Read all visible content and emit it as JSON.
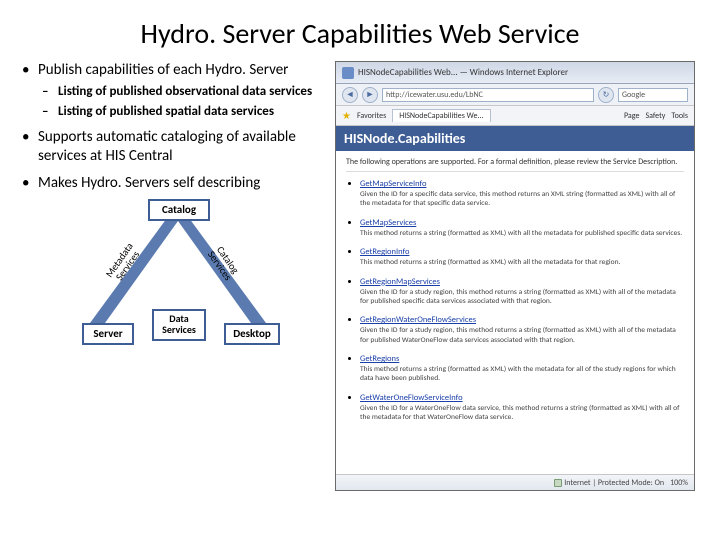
{
  "title": "Hydro. Server Capabilities Web Service",
  "bullets": [
    {
      "text": "Publish capabilities of each Hydro. Server",
      "sub": [
        "Listing of published observational data services",
        "Listing of published spatial data services"
      ]
    },
    {
      "text": "Supports automatic cataloging of available services at HIS Central"
    },
    {
      "text": "Makes Hydro. Servers self describing"
    }
  ],
  "diagram": {
    "top": "Catalog",
    "left": "Server",
    "right": "Desktop",
    "bottom": "Data\nServices",
    "edge_left": "Metadata\nServices",
    "edge_right": "Catalog\nServices"
  },
  "browser": {
    "window_title": "HISNodeCapabilities Web... — Windows Internet Explorer",
    "address": "http://icewater.usu.edu/LbNC",
    "search_placeholder": "Google",
    "favorites_label": "Favorites",
    "tab_label": "HISNodeCapabilities We...",
    "menu": [
      "Page",
      "Safety",
      "Tools"
    ],
    "banner": "HISNode.Capabilities",
    "intro": "The following operations are supported. For a formal definition, please review the Service Description.",
    "api": [
      {
        "name": "GetMapServiceInfo",
        "desc": "Given the ID for a specific data service, this method returns an XML string (formatted as XML) with all of the metadata for that specific data service."
      },
      {
        "name": "GetMapServices",
        "desc": "This method returns a string (formatted as XML) with all the metadata for published specific data services."
      },
      {
        "name": "GetRegionInfo",
        "desc": "This method returns a string (formatted as XML) with all the metadata for that region."
      },
      {
        "name": "GetRegionMapServices",
        "desc": "Given the ID for a study region, this method returns a string (formatted as XML) with all of the metadata for published specific data services associated with that region."
      },
      {
        "name": "GetRegionWaterOneFlowServices",
        "desc": "Given the ID for a study region, this method returns a string (formatted as XML) with all of the metadata for published WaterOneFlow data services associated with that region."
      },
      {
        "name": "GetRegions",
        "desc": "This method returns a string (formatted as XML) with the metadata for all of the study regions for which data have been published."
      },
      {
        "name": "GetWaterOneFlowServiceInfo",
        "desc": "Given the ID for a WaterOneFlow data service, this method returns a string (formatted as XML) with all of the metadata for that WaterOneFlow data service."
      }
    ],
    "status": {
      "zone": "Internet | Protected Mode: On",
      "zoom": "100%"
    }
  }
}
